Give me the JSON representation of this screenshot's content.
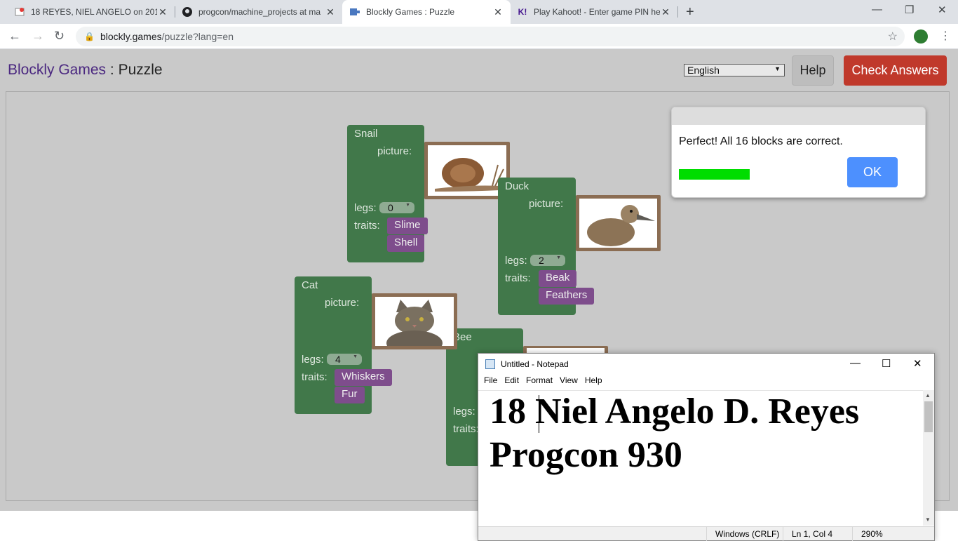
{
  "browser": {
    "tabs": [
      {
        "title": "18 REYES, NIEL ANGELO on 2019",
        "favicon": "classroom-icon"
      },
      {
        "title": "progcon/machine_projects at ma",
        "favicon": "github-icon"
      },
      {
        "title": "Blockly Games : Puzzle",
        "favicon": "blockly-icon",
        "active": true
      },
      {
        "title": "Play Kahoot! - Enter game PIN he",
        "favicon": "kahoot-icon"
      }
    ],
    "url_host": "blockly.games",
    "url_path": "/puzzle?lang=en"
  },
  "header": {
    "brand": "Blockly Games",
    "separator": " : ",
    "page": "Puzzle",
    "language": "English",
    "help_label": "Help",
    "check_label": "Check Answers"
  },
  "puzzle": {
    "picture_label": "picture:",
    "legs_label": "legs:",
    "traits_label": "traits:",
    "animals": [
      {
        "name": "Snail",
        "legs": "0",
        "traits": [
          "Slime",
          "Shell"
        ]
      },
      {
        "name": "Duck",
        "legs": "2",
        "traits": [
          "Beak",
          "Feathers"
        ]
      },
      {
        "name": "Cat",
        "legs": "4",
        "traits": [
          "Whiskers",
          "Fur"
        ]
      },
      {
        "name": "Bee"
      }
    ]
  },
  "dialog": {
    "message": "Perfect! All 16 blocks are correct.",
    "ok_label": "OK",
    "progress": 1.0
  },
  "notepad": {
    "title": "Untitled - Notepad",
    "menu": [
      "File",
      "Edit",
      "Format",
      "View",
      "Help"
    ],
    "lines": [
      "18 Niel Angelo D. Reyes",
      "Progcon 930"
    ],
    "status": {
      "encoding": "Windows (CRLF)",
      "position": "Ln 1, Col 4",
      "zoom": "290%"
    }
  },
  "colors": {
    "block_green": "#41784a",
    "trait_purple": "#7e4d8c",
    "check_red": "#c0392b",
    "ok_blue": "#4d90fe",
    "progress_green": "#00dd00",
    "brand_purple": "#4b2880"
  }
}
